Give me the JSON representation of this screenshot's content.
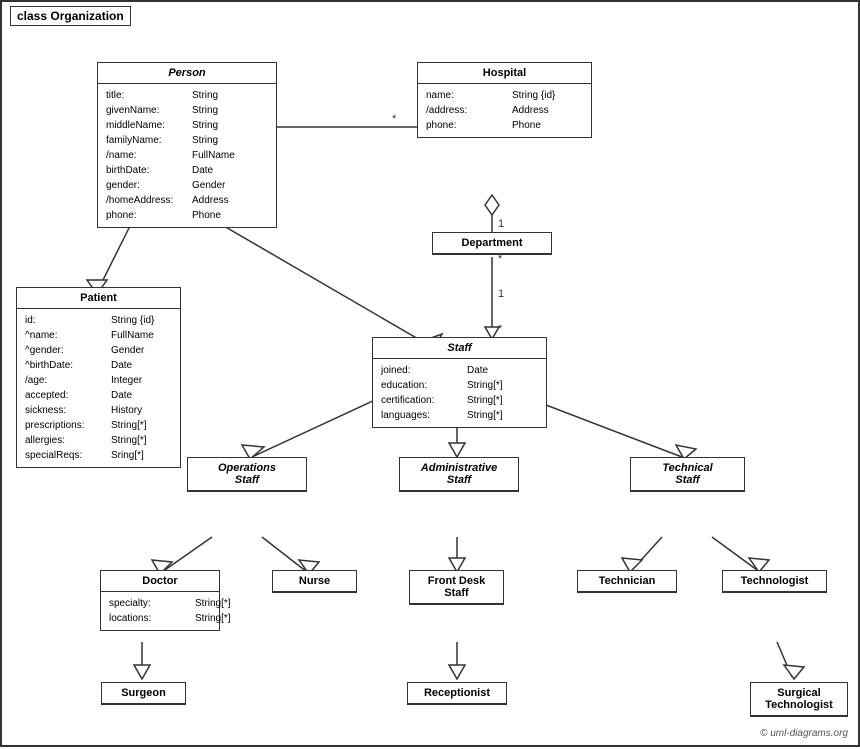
{
  "diagram": {
    "title": "class Organization",
    "classes": {
      "person": {
        "name": "Person",
        "italic": true,
        "attrs": [
          {
            "name": "title:",
            "type": "String"
          },
          {
            "name": "givenName:",
            "type": "String"
          },
          {
            "name": "middleName:",
            "type": "String"
          },
          {
            "name": "familyName:",
            "type": "String"
          },
          {
            "name": "/name:",
            "type": "FullName"
          },
          {
            "name": "birthDate:",
            "type": "Date"
          },
          {
            "name": "gender:",
            "type": "Gender"
          },
          {
            "name": "/homeAddress:",
            "type": "Address"
          },
          {
            "name": "phone:",
            "type": "Phone"
          }
        ]
      },
      "hospital": {
        "name": "Hospital",
        "italic": false,
        "attrs": [
          {
            "name": "name:",
            "type": "String {id}"
          },
          {
            "name": "/address:",
            "type": "Address"
          },
          {
            "name": "phone:",
            "type": "Phone"
          }
        ]
      },
      "department": {
        "name": "Department",
        "italic": false,
        "attrs": []
      },
      "staff": {
        "name": "Staff",
        "italic": true,
        "attrs": [
          {
            "name": "joined:",
            "type": "Date"
          },
          {
            "name": "education:",
            "type": "String[*]"
          },
          {
            "name": "certification:",
            "type": "String[*]"
          },
          {
            "name": "languages:",
            "type": "String[*]"
          }
        ]
      },
      "patient": {
        "name": "Patient",
        "italic": false,
        "attrs": [
          {
            "name": "id:",
            "type": "String {id}"
          },
          {
            "name": "^name:",
            "type": "FullName"
          },
          {
            "name": "^gender:",
            "type": "Gender"
          },
          {
            "name": "^birthDate:",
            "type": "Date"
          },
          {
            "name": "/age:",
            "type": "Integer"
          },
          {
            "name": "accepted:",
            "type": "Date"
          },
          {
            "name": "sickness:",
            "type": "History"
          },
          {
            "name": "prescriptions:",
            "type": "String[*]"
          },
          {
            "name": "allergies:",
            "type": "String[*]"
          },
          {
            "name": "specialReqs:",
            "type": "Sring[*]"
          }
        ]
      },
      "operations_staff": {
        "name": "Operations\nStaff",
        "italic": true
      },
      "administrative_staff": {
        "name": "Administrative\nStaff",
        "italic": true
      },
      "technical_staff": {
        "name": "Technical\nStaff",
        "italic": true
      },
      "doctor": {
        "name": "Doctor",
        "attrs": [
          {
            "name": "specialty:",
            "type": "String[*]"
          },
          {
            "name": "locations:",
            "type": "String[*]"
          }
        ]
      },
      "nurse": {
        "name": "Nurse",
        "attrs": []
      },
      "front_desk_staff": {
        "name": "Front Desk\nStaff",
        "attrs": []
      },
      "technician": {
        "name": "Technician",
        "attrs": []
      },
      "technologist": {
        "name": "Technologist",
        "attrs": []
      },
      "surgeon": {
        "name": "Surgeon",
        "attrs": []
      },
      "receptionist": {
        "name": "Receptionist",
        "attrs": []
      },
      "surgical_technologist": {
        "name": "Surgical\nTechnologist",
        "attrs": []
      }
    },
    "copyright": "© uml-diagrams.org"
  }
}
